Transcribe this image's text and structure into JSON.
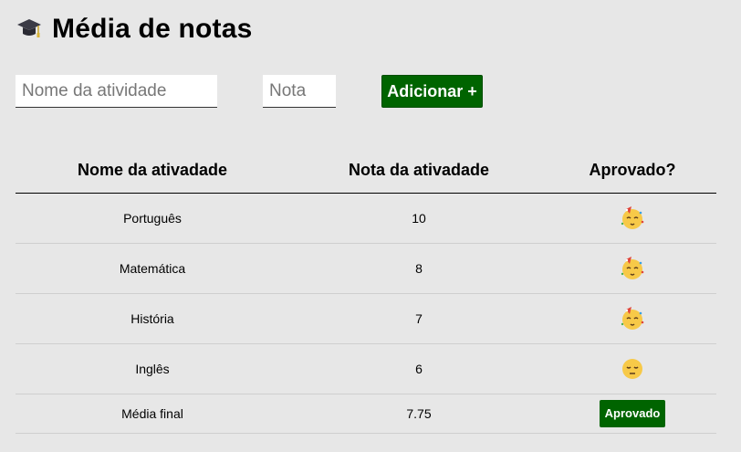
{
  "header": {
    "title": "Média de notas",
    "icon": "graduation-cap-icon"
  },
  "form": {
    "activity_placeholder": "Nome da atividade",
    "activity_value": "",
    "grade_placeholder": "Nota",
    "grade_value": "",
    "add_label": "Adicionar +"
  },
  "table": {
    "headers": [
      "Nome da ativadade",
      "Nota da ativadade",
      "Aprovado?"
    ],
    "rows": [
      {
        "name": "Português",
        "grade": "10",
        "status_icon": "celebrating-face-icon"
      },
      {
        "name": "Matemática",
        "grade": "8",
        "status_icon": "celebrating-face-icon"
      },
      {
        "name": "História",
        "grade": "7",
        "status_icon": "celebrating-face-icon"
      },
      {
        "name": "Inglês",
        "grade": "6",
        "status_icon": "disappointed-face-icon"
      }
    ],
    "final": {
      "label": "Média final",
      "value": "7.75",
      "status": "Aprovado"
    }
  },
  "colors": {
    "background": "#e7e7e7",
    "accent": "#006400"
  }
}
